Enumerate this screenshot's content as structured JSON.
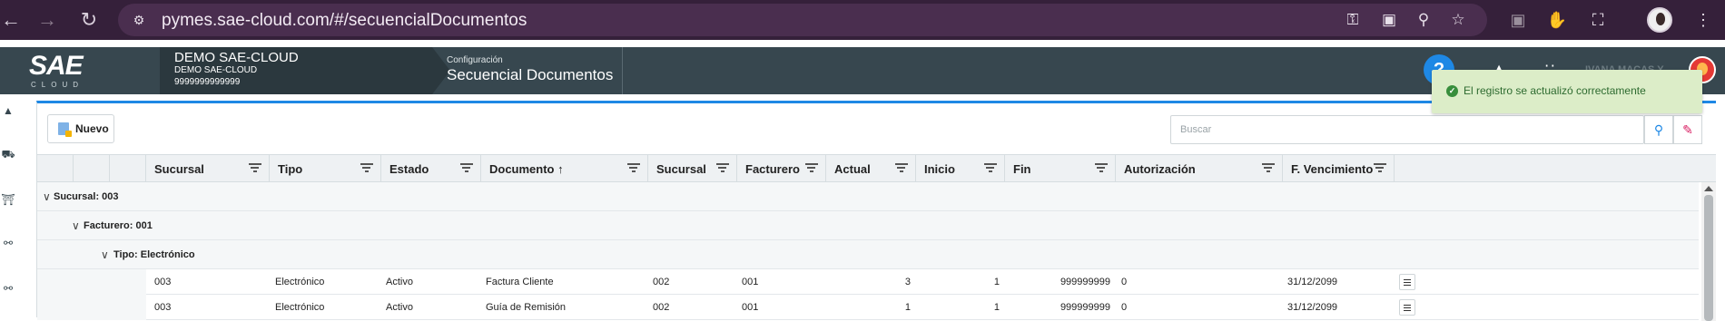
{
  "browser": {
    "url": "pymes.sae-cloud.com/#/secuencialDocumentos"
  },
  "header": {
    "logo_text": "SAE",
    "logo_sub": "CLOUD",
    "company_name": "DEMO SAE-CLOUD",
    "company_sub": "DEMO SAE-CLOUD",
    "company_id": "9999999999999",
    "breadcrumb_section": "Configuración",
    "breadcrumb_page": "Secuencial Documentos",
    "help_label": "?",
    "user_name": "IVANA MACAS Y..."
  },
  "toolbar": {
    "new_label": "Nuevo",
    "search_placeholder": "Buscar"
  },
  "toast": {
    "message": "El registro se actualizó correctamente"
  },
  "grid": {
    "columns": [
      {
        "label": "Sucursal"
      },
      {
        "label": "Tipo"
      },
      {
        "label": "Estado"
      },
      {
        "label": "Documento ↑"
      },
      {
        "label": "Sucursal"
      },
      {
        "label": "Facturero"
      },
      {
        "label": "Actual"
      },
      {
        "label": "Inicio"
      },
      {
        "label": "Fin"
      },
      {
        "label": "Autorización"
      },
      {
        "label": "F. Vencimiento"
      }
    ],
    "groups": {
      "level1": "Sucursal: 003",
      "level2": "Facturero: 001",
      "level3": "Tipo: Electrónico"
    },
    "rows": [
      {
        "sucursal": "003",
        "tipo": "Electrónico",
        "estado": "Activo",
        "documento": "Factura Cliente",
        "sucursal2": "002",
        "facturero": "001",
        "actual": "3",
        "inicio": "1",
        "fin": "999999999",
        "autorizacion": "0",
        "vencimiento": "31/12/2099"
      },
      {
        "sucursal": "003",
        "tipo": "Electrónico",
        "estado": "Activo",
        "documento": "Guía de Remisión",
        "sucursal2": "002",
        "facturero": "001",
        "actual": "1",
        "inicio": "1",
        "fin": "999999999",
        "autorizacion": "0",
        "vencimiento": "31/12/2099"
      }
    ]
  },
  "colors": {
    "browser_bg": "#35203a",
    "header_bg": "#37474f",
    "accent": "#1e88e5",
    "toast_bg": "#dcedc8"
  }
}
